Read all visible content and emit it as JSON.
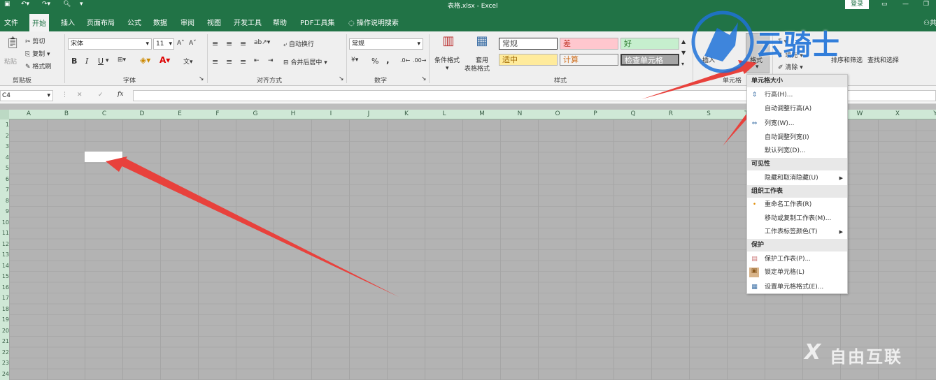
{
  "titlebar": {
    "filename": "表格.xlsx",
    "sep": "-",
    "app": "Excel",
    "login": "登录",
    "user_partial": "共"
  },
  "tabs": [
    "文件",
    "开始",
    "插入",
    "页面布局",
    "公式",
    "数据",
    "审阅",
    "视图",
    "开发工具",
    "帮助",
    "PDF工具集"
  ],
  "tell_me": "操作说明搜索",
  "clipboard": {
    "paste": "粘贴",
    "cut": "剪切",
    "copy": "复制",
    "format_painter": "格式刷",
    "label": "剪贴板"
  },
  "font": {
    "name": "宋体",
    "size": "11",
    "bold": "B",
    "italic": "I",
    "underline": "U",
    "label": "字体"
  },
  "alignment": {
    "wrap": "自动换行",
    "merge": "合并后居中",
    "label": "对齐方式"
  },
  "number": {
    "format": "常规",
    "percent": "%",
    "comma": ",",
    "label": "数字"
  },
  "styles": {
    "conditional": "条件格式",
    "table_fmt1": "套用",
    "table_fmt2": "表格格式",
    "normal": "常规",
    "bad": "差",
    "good": "好",
    "neutral": "适中",
    "calc": "计算",
    "check": "检查单元格",
    "label": "样式"
  },
  "cells": {
    "insert": "插入",
    "format": "格式",
    "label": "单元格"
  },
  "editing": {
    "fill": "填充",
    "clear": "清除",
    "sort": "排序和筛选",
    "find": "查找和选择"
  },
  "namebox": "C4",
  "fx": "fx",
  "columns": [
    "A",
    "B",
    "C",
    "D",
    "E",
    "F",
    "G",
    "H",
    "I",
    "J",
    "K",
    "L",
    "M",
    "N",
    "O",
    "P",
    "Q",
    "R",
    "S",
    "T",
    "U",
    "V",
    "W",
    "X",
    "Y"
  ],
  "rows": [
    "1",
    "2",
    "3",
    "4",
    "5",
    "6",
    "7",
    "8",
    "9",
    "10",
    "11",
    "12",
    "13",
    "14",
    "15",
    "16",
    "17",
    "18",
    "19",
    "20",
    "21",
    "22",
    "23",
    "24"
  ],
  "menu": {
    "h1": "单元格大小",
    "row_height": "行高(H)...",
    "autofit_row": "自动调整行高(A)",
    "col_width": "列宽(W)...",
    "autofit_col": "自动调整列宽(I)",
    "default_width": "默认列宽(D)...",
    "h2": "可见性",
    "hide": "隐藏和取消隐藏(U)",
    "h3": "组织工作表",
    "rename": "重命名工作表(R)",
    "move_copy": "移动或复制工作表(M)...",
    "tab_color": "工作表标签颜色(T)",
    "h4": "保护",
    "protect": "保护工作表(P)...",
    "lock": "锁定单元格(L)",
    "format_cells": "设置单元格格式(E)..."
  },
  "watermark": {
    "brand1": "云骑士",
    "brand2": "自由互联"
  },
  "colors": {
    "excel_green": "#217346",
    "arrow_red": "#e8413c",
    "bad_bg": "#ffc7ce",
    "good_bg": "#c6efce",
    "neutral_bg": "#ffeb9c",
    "check_bg": "#a5a5a5",
    "watermark_blue": "#1e72d8"
  }
}
